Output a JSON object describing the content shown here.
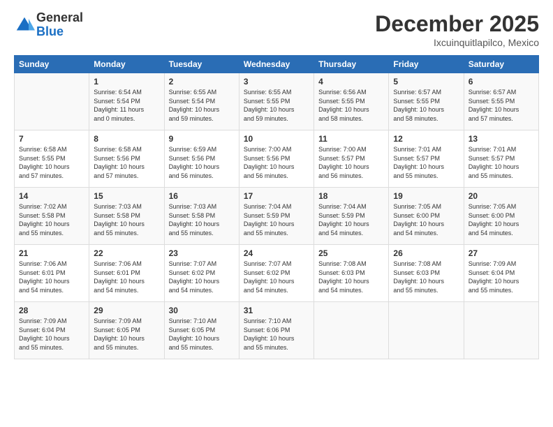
{
  "logo": {
    "general": "General",
    "blue": "Blue"
  },
  "title": "December 2025",
  "subtitle": "Ixcuinquitlapilco, Mexico",
  "days_of_week": [
    "Sunday",
    "Monday",
    "Tuesday",
    "Wednesday",
    "Thursday",
    "Friday",
    "Saturday"
  ],
  "weeks": [
    [
      {
        "day": "",
        "info": ""
      },
      {
        "day": "1",
        "info": "Sunrise: 6:54 AM\nSunset: 5:54 PM\nDaylight: 11 hours\nand 0 minutes."
      },
      {
        "day": "2",
        "info": "Sunrise: 6:55 AM\nSunset: 5:54 PM\nDaylight: 10 hours\nand 59 minutes."
      },
      {
        "day": "3",
        "info": "Sunrise: 6:55 AM\nSunset: 5:55 PM\nDaylight: 10 hours\nand 59 minutes."
      },
      {
        "day": "4",
        "info": "Sunrise: 6:56 AM\nSunset: 5:55 PM\nDaylight: 10 hours\nand 58 minutes."
      },
      {
        "day": "5",
        "info": "Sunrise: 6:57 AM\nSunset: 5:55 PM\nDaylight: 10 hours\nand 58 minutes."
      },
      {
        "day": "6",
        "info": "Sunrise: 6:57 AM\nSunset: 5:55 PM\nDaylight: 10 hours\nand 57 minutes."
      }
    ],
    [
      {
        "day": "7",
        "info": "Sunrise: 6:58 AM\nSunset: 5:55 PM\nDaylight: 10 hours\nand 57 minutes."
      },
      {
        "day": "8",
        "info": "Sunrise: 6:58 AM\nSunset: 5:56 PM\nDaylight: 10 hours\nand 57 minutes."
      },
      {
        "day": "9",
        "info": "Sunrise: 6:59 AM\nSunset: 5:56 PM\nDaylight: 10 hours\nand 56 minutes."
      },
      {
        "day": "10",
        "info": "Sunrise: 7:00 AM\nSunset: 5:56 PM\nDaylight: 10 hours\nand 56 minutes."
      },
      {
        "day": "11",
        "info": "Sunrise: 7:00 AM\nSunset: 5:57 PM\nDaylight: 10 hours\nand 56 minutes."
      },
      {
        "day": "12",
        "info": "Sunrise: 7:01 AM\nSunset: 5:57 PM\nDaylight: 10 hours\nand 55 minutes."
      },
      {
        "day": "13",
        "info": "Sunrise: 7:01 AM\nSunset: 5:57 PM\nDaylight: 10 hours\nand 55 minutes."
      }
    ],
    [
      {
        "day": "14",
        "info": "Sunrise: 7:02 AM\nSunset: 5:58 PM\nDaylight: 10 hours\nand 55 minutes."
      },
      {
        "day": "15",
        "info": "Sunrise: 7:03 AM\nSunset: 5:58 PM\nDaylight: 10 hours\nand 55 minutes."
      },
      {
        "day": "16",
        "info": "Sunrise: 7:03 AM\nSunset: 5:58 PM\nDaylight: 10 hours\nand 55 minutes."
      },
      {
        "day": "17",
        "info": "Sunrise: 7:04 AM\nSunset: 5:59 PM\nDaylight: 10 hours\nand 55 minutes."
      },
      {
        "day": "18",
        "info": "Sunrise: 7:04 AM\nSunset: 5:59 PM\nDaylight: 10 hours\nand 54 minutes."
      },
      {
        "day": "19",
        "info": "Sunrise: 7:05 AM\nSunset: 6:00 PM\nDaylight: 10 hours\nand 54 minutes."
      },
      {
        "day": "20",
        "info": "Sunrise: 7:05 AM\nSunset: 6:00 PM\nDaylight: 10 hours\nand 54 minutes."
      }
    ],
    [
      {
        "day": "21",
        "info": "Sunrise: 7:06 AM\nSunset: 6:01 PM\nDaylight: 10 hours\nand 54 minutes."
      },
      {
        "day": "22",
        "info": "Sunrise: 7:06 AM\nSunset: 6:01 PM\nDaylight: 10 hours\nand 54 minutes."
      },
      {
        "day": "23",
        "info": "Sunrise: 7:07 AM\nSunset: 6:02 PM\nDaylight: 10 hours\nand 54 minutes."
      },
      {
        "day": "24",
        "info": "Sunrise: 7:07 AM\nSunset: 6:02 PM\nDaylight: 10 hours\nand 54 minutes."
      },
      {
        "day": "25",
        "info": "Sunrise: 7:08 AM\nSunset: 6:03 PM\nDaylight: 10 hours\nand 54 minutes."
      },
      {
        "day": "26",
        "info": "Sunrise: 7:08 AM\nSunset: 6:03 PM\nDaylight: 10 hours\nand 55 minutes."
      },
      {
        "day": "27",
        "info": "Sunrise: 7:09 AM\nSunset: 6:04 PM\nDaylight: 10 hours\nand 55 minutes."
      }
    ],
    [
      {
        "day": "28",
        "info": "Sunrise: 7:09 AM\nSunset: 6:04 PM\nDaylight: 10 hours\nand 55 minutes."
      },
      {
        "day": "29",
        "info": "Sunrise: 7:09 AM\nSunset: 6:05 PM\nDaylight: 10 hours\nand 55 minutes."
      },
      {
        "day": "30",
        "info": "Sunrise: 7:10 AM\nSunset: 6:05 PM\nDaylight: 10 hours\nand 55 minutes."
      },
      {
        "day": "31",
        "info": "Sunrise: 7:10 AM\nSunset: 6:06 PM\nDaylight: 10 hours\nand 55 minutes."
      },
      {
        "day": "",
        "info": ""
      },
      {
        "day": "",
        "info": ""
      },
      {
        "day": "",
        "info": ""
      }
    ]
  ]
}
